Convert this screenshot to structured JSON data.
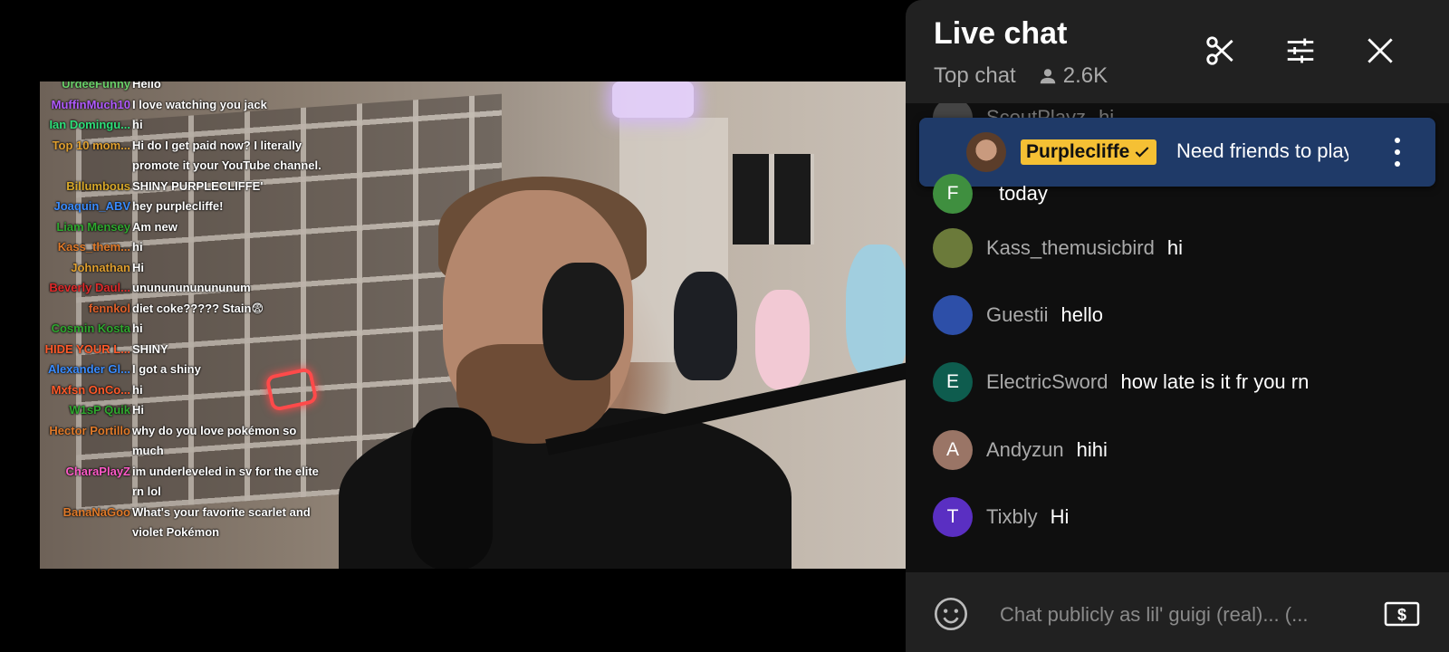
{
  "overlay_chat": [
    {
      "name": "UrdeeFunny",
      "color": "#6ad06a",
      "msg": "Hello"
    },
    {
      "name": "MuffinMuch10",
      "color": "#b15bff",
      "msg": "I love watching you jack"
    },
    {
      "name": "Ian Domingu...",
      "color": "#2fe07a",
      "msg": "hi"
    },
    {
      "name": "Top 10 mom...",
      "color": "#e0a030",
      "msg": "Hi do I get paid now? I literally promote it your YouTube channel."
    },
    {
      "name": "Billumbous",
      "color": "#d9a92a",
      "msg": "SHINY PURPLECLIFFE'"
    },
    {
      "name": "Joaquin_ABV",
      "color": "#3a8cff",
      "msg": "hey purplecliffe!"
    },
    {
      "name": "Liam Mensey",
      "color": "#2fa82f",
      "msg": "Am new"
    },
    {
      "name": "Kass_them...",
      "color": "#e07a2a",
      "msg": "hi"
    },
    {
      "name": "Johnathan",
      "color": "#e0a030",
      "msg": "Hi"
    },
    {
      "name": "Beverly Daul...",
      "color": "#e02a2a",
      "msg": "unununununununum"
    },
    {
      "name": "fennkol",
      "color": "#e0602a",
      "msg": "diet coke????? Stain😨"
    },
    {
      "name": "Cosmin Kosta",
      "color": "#2fa82f",
      "msg": "hi"
    },
    {
      "name": "HIDE YOUR L...",
      "color": "#ff5a2a",
      "msg": "SHINY"
    },
    {
      "name": "Alexander Gl...",
      "color": "#3a8cff",
      "msg": "I got a shiny"
    },
    {
      "name": "Mxfsn OnCo...",
      "color": "#ff5a2a",
      "msg": "hi"
    },
    {
      "name": "W1sP Quik",
      "color": "#2fa82f",
      "msg": "Hi"
    },
    {
      "name": "Hector Portillo",
      "color": "#e07a2a",
      "msg": "why do you love pokémon so much"
    },
    {
      "name": "CharaPlayZ",
      "color": "#ff5ac8",
      "msg": "im underleveled in sv for the elite rn lol"
    },
    {
      "name": "BanaNaGoo",
      "color": "#e07a2a",
      "msg": "What's your favorite scarlet and violet Pokémon"
    }
  ],
  "header": {
    "title": "Live chat",
    "mode": "Top chat",
    "viewers": "2.6K"
  },
  "faded_row": {
    "author": "ScoutPlayz",
    "text": "hi"
  },
  "pinned": {
    "author": "Purplecliffe",
    "message": "Need friends to play"
  },
  "messages": [
    {
      "initial": "F",
      "author": "",
      "text": "today",
      "avatar_color": "#3f8f3f"
    },
    {
      "initial": "",
      "author": "Kass_themusicbird",
      "text": "hi",
      "avatar_color": "#6b7a3a"
    },
    {
      "initial": "",
      "author": "Guestii",
      "text": "hello",
      "avatar_color": "#2d4fa8"
    },
    {
      "initial": "E",
      "author": "ElectricSword",
      "text": "how late is it fr you rn",
      "avatar_color": "#0e5c4e"
    },
    {
      "initial": "A",
      "author": "Andyzun",
      "text": "hihi",
      "avatar_color": "#9a7566"
    },
    {
      "initial": "T",
      "author": "Tixbly",
      "text": "Hi",
      "avatar_color": "#5a2fc2"
    }
  ],
  "footer": {
    "placeholder": "Chat publicly as lil' guigi (real)... (..."
  },
  "colors": {
    "panel_bg": "#0f0f0f",
    "header_bg": "#212121",
    "pinned_bg": "#1f3a68",
    "badge": "#f5c034"
  },
  "icons": [
    "clip-icon",
    "filter-icon",
    "close-icon",
    "person-icon",
    "emoji-icon",
    "super-chat-icon",
    "more-vert-icon",
    "check-icon"
  ]
}
